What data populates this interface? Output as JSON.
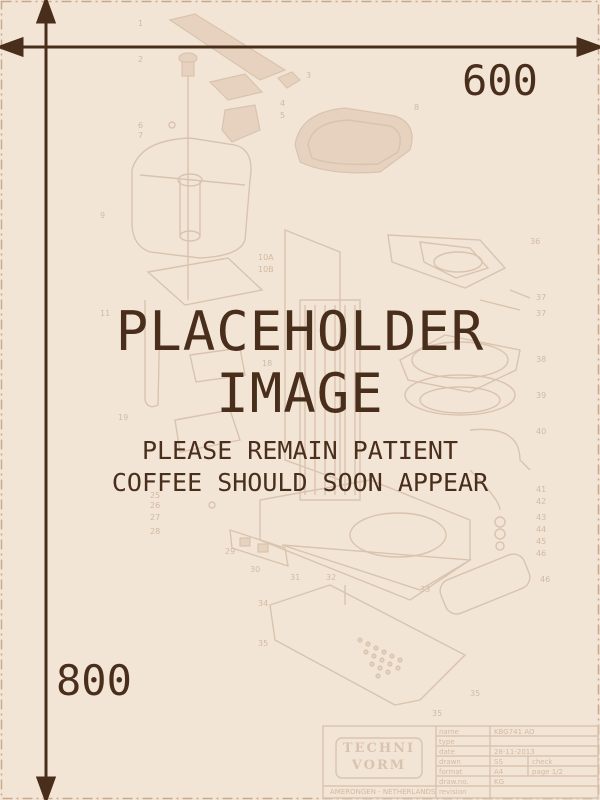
{
  "placeholder": {
    "line1": "PLACEHOLDER",
    "line2": "IMAGE",
    "line3": "PLEASE REMAIN PATIENT",
    "line4": "COFFEE SHOULD SOON APPEAR"
  },
  "dimensions": {
    "width_label": "600",
    "height_label": "800"
  },
  "title_block": {
    "logo_line1": "TECHNI",
    "logo_line2": "VORM",
    "company": "AMERONGEN - NETHERLANDS",
    "rows": [
      {
        "label": "name",
        "value": "KBG741 AO"
      },
      {
        "label": "type",
        "value": ""
      },
      {
        "label": "date",
        "value": "28-11-2013"
      },
      {
        "label": "drawn",
        "value": "SS",
        "extra_label": "check",
        "extra_value": ""
      },
      {
        "label": "format",
        "value": "A4",
        "extra_label": "page 1/2",
        "extra_value": ""
      },
      {
        "label": "draw.no.",
        "value": "KG"
      },
      {
        "label": "revision",
        "value": ""
      }
    ]
  },
  "part_numbers": [
    "1",
    "2",
    "3",
    "4",
    "5",
    "6",
    "7",
    "8",
    "9",
    "10A",
    "10B",
    "11",
    "18",
    "19",
    "25",
    "26",
    "27",
    "28",
    "29",
    "30",
    "31",
    "32",
    "33",
    "34",
    "35",
    "36",
    "37",
    "38",
    "39",
    "40",
    "41",
    "42",
    "43",
    "44",
    "45",
    "46"
  ],
  "colors": {
    "background": "#f3e5d6",
    "text": "#4a2e1c",
    "drawing": "#d9c3ae"
  }
}
